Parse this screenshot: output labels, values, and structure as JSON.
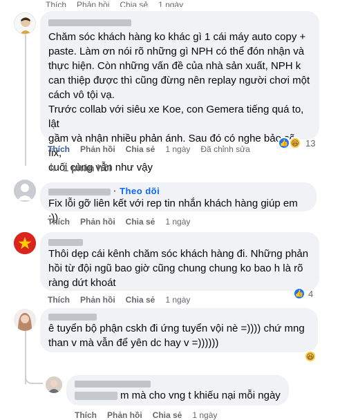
{
  "top_strip": {
    "like": "Thích",
    "reply": "Phản hồi",
    "share": "Chia sẻ",
    "time": "1 ngày"
  },
  "comments": [
    {
      "text": "Chăm sóc khách hàng ko khác gì 1 cái máy auto copy +\npaste. Làm ơn nói rõ những gì NPH có thể đón nhận và\nthực hiện. Còn những vấn đề của nhà sản xuất, NPH k\ncan thiệp được thì cũng đừng nên replay người chơi một\ncách vô tội vạ.\nTrước collab với siêu xe Koe, con Gemera tiếng quá to, lật\ngầm và nhận nhiều phản ánh. Sau đó có nghe bảo sẽ fix,\ncuối cùng vẫn như vậy",
      "like": "Thích",
      "reply": "Phản hồi",
      "share": "Chia sẻ",
      "time": "1 ngày",
      "edited": "Đã chỉnh sửa",
      "reaction_count": "13",
      "replies_link": "1 phản hồi"
    },
    {
      "follow": "Theo dõi",
      "text": "Fix lỗi gỡ liên kết với rep tin nhắn khách hàng giúp em :))",
      "like": "Thích",
      "reply": "Phản hồi",
      "share": "Chia sẻ",
      "time": "1 ngày"
    },
    {
      "text": "Thôi dẹp cái kênh chăm sóc khách hàng đi. Những phản\nhồi từ đội ngũ bao giờ cũng chung chung ko bao h là rõ\nràng dứt khoát",
      "like": "Thích",
      "reply": "Phản hồi",
      "share": "Chia sẻ",
      "time": "1 ngày",
      "reaction_count": "4"
    },
    {
      "text": "ê tuyển bộ phận cskh đi ứng tuyển vội nè =)))) chứ mng\nthan v mà vẫn để yên dc hay v =))))))"
    }
  ],
  "reply": {
    "text": "m mà cho vng t khiếu nại mỗi ngày",
    "like": "Thích",
    "reply": "Phản hồi",
    "share": "Chia sẻ",
    "time": "1 ngày"
  },
  "colors": {
    "bubble": "#f0f2f5",
    "meta": "#65676b",
    "link": "#0866ff",
    "like_reaction": "#1877f2",
    "haha_reaction": "#f7c948"
  }
}
